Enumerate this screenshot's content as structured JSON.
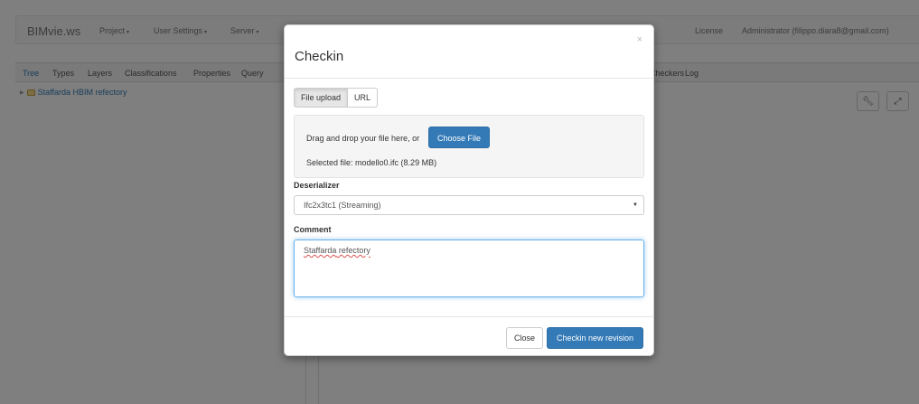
{
  "navbar": {
    "brand": "BIMvie.ws",
    "menus": [
      "Project",
      "User Settings",
      "Server"
    ],
    "license": "License",
    "user": "Administrator (filippo.diara8@gmail.com)"
  },
  "tabs": {
    "left": [
      "Tree",
      "Types",
      "Layers",
      "Classifications",
      "Properties",
      "Query"
    ],
    "right": [
      "Checkers",
      "Log"
    ]
  },
  "tree": {
    "item": "Staffarda HBIM refectory"
  },
  "icons": {
    "wrench": "wrench-icon",
    "expand": "expand-icon",
    "folder": "folder-icon"
  },
  "modal": {
    "title": "Checkin",
    "close_glyph": "×",
    "source_tabs": [
      "File upload",
      "URL"
    ],
    "drop_text": "Drag and drop your file here, or",
    "choose_file": "Choose File",
    "selected_file": "Selected file: modello0.ifc (8.29 MB)",
    "deserializer_label": "Deserializer",
    "deserializer_value": "Ifc2x3tc1 (Streaming)",
    "comment_label": "Comment",
    "comment_word1": "Staffarda",
    "comment_word2": " refectory",
    "close_button": "Close",
    "submit_button": "Checkin new revision"
  },
  "colors": {
    "primary": "#337ab7",
    "backdrop": "rgba(0,0,0,0.5)"
  }
}
